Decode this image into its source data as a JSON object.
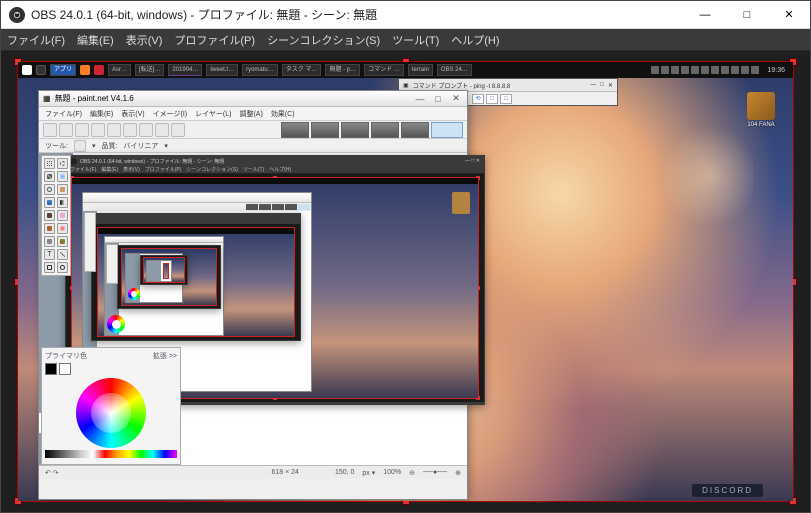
{
  "window": {
    "title": "OBS 24.0.1 (64-bit, windows) - プロファイル: 無題 - シーン: 無題",
    "btn_min": "—",
    "btn_max": "□",
    "btn_close": "✕"
  },
  "obs_menu": {
    "file": "ファイル(F)",
    "edit": "編集(E)",
    "view": "表示(V)",
    "profile": "プロファイル(P)",
    "scenes": "シーンコレクション(S)",
    "tools": "ツール(T)",
    "help": "ヘルプ(H)"
  },
  "taskbar": {
    "items": [
      {
        "label": "アプリ",
        "color": "#2558a8"
      },
      {
        "label": "",
        "color": "#ff7f27"
      },
      {
        "label": "Asr…"
      },
      {
        "label": "[転送]…"
      },
      {
        "label": "201904…",
        "color": "#6b3fa0"
      },
      {
        "label": "tweet.t…"
      },
      {
        "label": "ryomatu…"
      },
      {
        "label": "タスク マ…"
      },
      {
        "label": "無題 - p…"
      },
      {
        "label": "コマンド …"
      },
      {
        "label": "terrain"
      },
      {
        "label": "OBS 24…"
      }
    ],
    "clock": "19:36"
  },
  "desk_icon": {
    "label": "104 FANA"
  },
  "discord_label": "DISCORD",
  "pdn": {
    "title": "無題 - paint.net V4.1.6",
    "menu": {
      "file": "ファイル(F)",
      "edit": "編集(E)",
      "view": "表示(V)",
      "image": "イメージ(I)",
      "layer": "レイヤー(L)",
      "adjust": "調整(A)",
      "effect": "効果(C)"
    },
    "tool2": {
      "tool_label": "ツール:",
      "quality_label": "品質:",
      "quality_value": "バイリニア"
    },
    "color": {
      "primary": "プライマリ色",
      "expand": "拡張 >>"
    },
    "status": {
      "size": "618 × 24",
      "pos": "150, 0",
      "zoom_label": "px ▾",
      "zoom": "100%"
    }
  },
  "cmd": {
    "title": "コマンド プロンプト - ping -t 8.8.8.8"
  },
  "nest": {
    "title": "OBS 24.0.1 (64-bit, windows) - プロファイル: 無題 - シーン: 無題",
    "menu": {
      "file": "ファイル(F)",
      "edit": "編集(E)",
      "view": "表示(V)",
      "profile": "プロファイル(P)",
      "scenes": "シーンコレクション(S)",
      "tools": "ツール(T)",
      "help": "ヘルプ(H)"
    }
  }
}
